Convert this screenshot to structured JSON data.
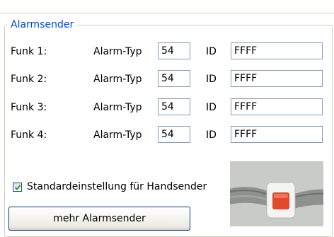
{
  "group": {
    "title": "Alarmsender"
  },
  "rows": [
    {
      "funk": "Funk 1:",
      "alarm_typ_label": "Alarm-Typ",
      "alarm_typ": "54",
      "id_label": "ID",
      "id": "FFFF"
    },
    {
      "funk": "Funk 2:",
      "alarm_typ_label": "Alarm-Typ",
      "alarm_typ": "54",
      "id_label": "ID",
      "id": "FFFF"
    },
    {
      "funk": "Funk 3:",
      "alarm_typ_label": "Alarm-Typ",
      "alarm_typ": "54",
      "id_label": "ID",
      "id": "FFFF"
    },
    {
      "funk": "Funk 4:",
      "alarm_typ_label": "Alarm-Typ",
      "alarm_typ": "54",
      "id_label": "ID",
      "id": "FFFF"
    }
  ],
  "checkbox": {
    "label": "Standardeinstellung für Handsender",
    "checked": true
  },
  "button": {
    "label": "mehr Alarmsender"
  },
  "colors": {
    "group_title": "#0046d5",
    "field_border": "#7f9db9",
    "checkmark": "#21a121"
  },
  "image": {
    "icon": "wristband-transmitter-photo"
  }
}
